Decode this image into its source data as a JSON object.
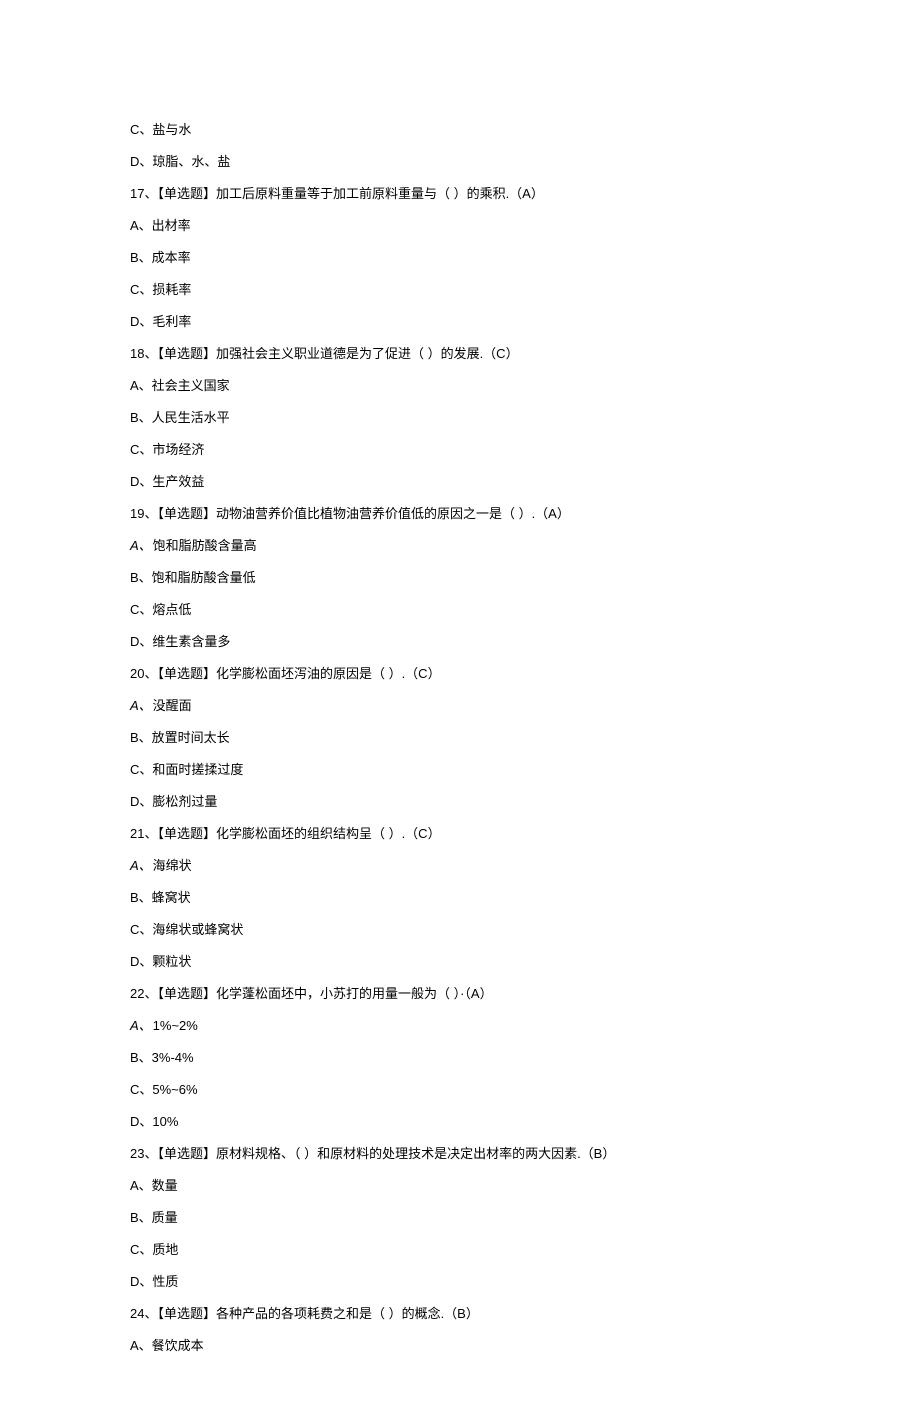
{
  "lines": [
    {
      "type": "option",
      "label": "C、",
      "text": "盐与水"
    },
    {
      "type": "option",
      "label": "D、",
      "text": "琼脂、水、盐"
    },
    {
      "type": "question",
      "text": "17、【单选题】加工后原料重量等于加工前原料重量与（ ）的乘积.（A）"
    },
    {
      "type": "option",
      "label": "A、",
      "text": "出材率"
    },
    {
      "type": "option",
      "label": "B、",
      "text": "成本率"
    },
    {
      "type": "option",
      "label": "C、",
      "text": "损耗率"
    },
    {
      "type": "option",
      "label": "D、",
      "text": "毛利率"
    },
    {
      "type": "question",
      "text": "18、【单选题】加强社会主义职业道德是为了促进（ ）的发展.（C）"
    },
    {
      "type": "option",
      "label": "A、",
      "text": "社会主义国家"
    },
    {
      "type": "option",
      "label": "B、",
      "text": "人民生活水平"
    },
    {
      "type": "option",
      "label": "C、",
      "text": "市场经济"
    },
    {
      "type": "option",
      "label": "D、",
      "text": "生产效益"
    },
    {
      "type": "question",
      "text": "19、【单选题】动物油营养价值比植物油营养价值低的原因之一是（ ）.（A）"
    },
    {
      "type": "option-italic",
      "label": "A、",
      "text": "饱和脂肪酸含量高"
    },
    {
      "type": "option",
      "label": "B、",
      "text": "饱和脂肪酸含量低"
    },
    {
      "type": "option",
      "label": "C、",
      "text": "熔点低"
    },
    {
      "type": "option",
      "label": "D、",
      "text": "维生素含量多"
    },
    {
      "type": "question",
      "text": "20、【单选题】化学膨松面坯泻油的原因是（ ）.（C）"
    },
    {
      "type": "option-italic",
      "label": "A、",
      "text": "没醒面"
    },
    {
      "type": "option",
      "label": "B、",
      "text": "放置时间太长"
    },
    {
      "type": "option",
      "label": "C、",
      "text": "和面时搓揉过度"
    },
    {
      "type": "option",
      "label": "D、",
      "text": "膨松剂过量"
    },
    {
      "type": "question",
      "text": "21、【单选题】化学膨松面坯的组织结构呈（ ）.（C）"
    },
    {
      "type": "option-italic",
      "label": "A、",
      "text": "海绵状"
    },
    {
      "type": "option",
      "label": "B、",
      "text": "蜂窝状"
    },
    {
      "type": "option",
      "label": "C、",
      "text": "海绵状或蜂窝状"
    },
    {
      "type": "option",
      "label": "D、",
      "text": "颗粒状"
    },
    {
      "type": "question",
      "text": "22、【单选题】化学蓬松面坯中，小苏打的用量一般为（ ）·（A）"
    },
    {
      "type": "option-italic",
      "label": "A、",
      "text": "1%~2%"
    },
    {
      "type": "option",
      "label": "B、",
      "text": "3%-4%"
    },
    {
      "type": "option",
      "label": "C、",
      "text": "5%~6%"
    },
    {
      "type": "option",
      "label": "D、",
      "text": "10%"
    },
    {
      "type": "question",
      "text": "23、【单选题】原材料规格、（ ）和原材料的处理技术是决定出材率的两大因素.（B）"
    },
    {
      "type": "option",
      "label": "A、",
      "text": "数量"
    },
    {
      "type": "option",
      "label": "B、",
      "text": "质量"
    },
    {
      "type": "option",
      "label": "C、",
      "text": "质地"
    },
    {
      "type": "option",
      "label": "D、",
      "text": "性质"
    },
    {
      "type": "question",
      "text": "24、【单选题】各种产品的各项耗费之和是（ ）的概念.（B）"
    },
    {
      "type": "option",
      "label": "A、",
      "text": "餐饮成本"
    }
  ]
}
